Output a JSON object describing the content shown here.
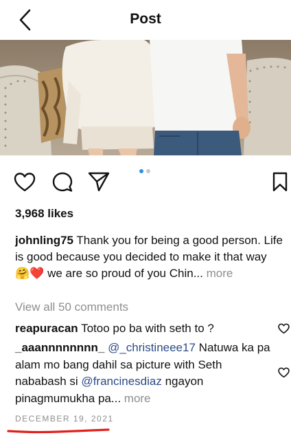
{
  "header": {
    "title": "Post",
    "back_icon": "chevron-left-icon"
  },
  "actions": {
    "like_icon": "heart-icon",
    "comment_icon": "comment-icon",
    "share_icon": "send-icon",
    "save_icon": "bookmark-icon"
  },
  "carousel": {
    "total": 2,
    "current": 1,
    "active_color": "#2f8fe6"
  },
  "likes": {
    "text": "3,968 likes"
  },
  "caption": {
    "username": "johnling75",
    "text_part1": "Thank you for being a good person. Life is good because you decided to make it that way",
    "emoji": "🤗❤️",
    "text_part2": "we are so proud of you Chin...",
    "more": "more"
  },
  "view_comments": "View all 50 comments",
  "comments": [
    {
      "username": "reapuracan",
      "text": "Totoo po ba with seth to ?"
    },
    {
      "username": "_aaannnnnnnn_",
      "mention1": "@_christineee17",
      "text1": "Natuwa ka pa alam mo bang dahil sa picture with Seth nababash si",
      "mention2": "@francinesdiaz",
      "text2": "ngayon pinagmumukha pa...",
      "more": "more"
    }
  ],
  "date": "DECEMBER 19, 2021",
  "colors": {
    "mention": "#2c4b86",
    "muted": "#8e8e8e",
    "annotation": "#e0201b"
  }
}
